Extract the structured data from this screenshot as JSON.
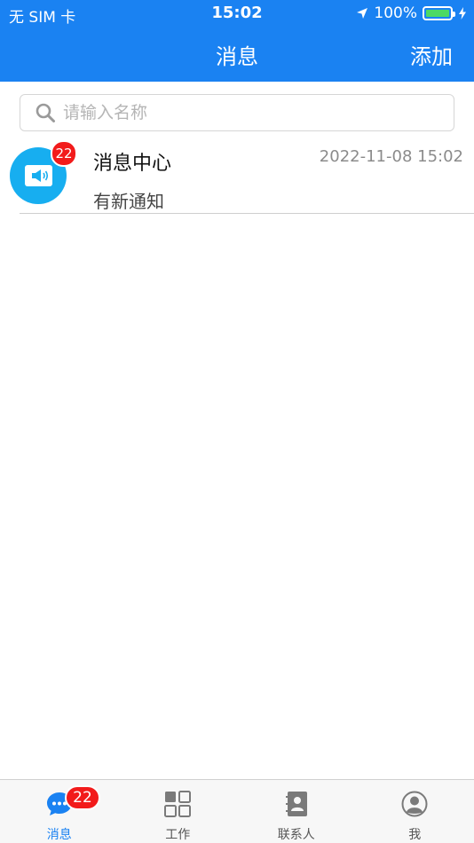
{
  "status_bar": {
    "carrier": "无 SIM 卡",
    "time": "15:02",
    "battery": "100%"
  },
  "nav": {
    "title": "消息",
    "add_label": "添加"
  },
  "search": {
    "placeholder": "请输入名称",
    "value": ""
  },
  "messages": [
    {
      "title": "消息中心",
      "time": "2022-11-08 15:02",
      "subtitle": "有新通知",
      "badge": "22",
      "icon": "megaphone-icon"
    }
  ],
  "tabbar": {
    "items": [
      {
        "label": "消息",
        "icon": "chat-bubble-icon",
        "badge": "22",
        "active": true
      },
      {
        "label": "工作",
        "icon": "grid-icon",
        "active": false
      },
      {
        "label": "联系人",
        "icon": "contacts-book-icon",
        "active": false
      },
      {
        "label": "我",
        "icon": "user-profile-icon",
        "active": false
      }
    ]
  },
  "colors": {
    "primary": "#1a82f2",
    "badge": "#f21b1b",
    "avatar": "#17aef0",
    "battery": "#4cd964"
  }
}
